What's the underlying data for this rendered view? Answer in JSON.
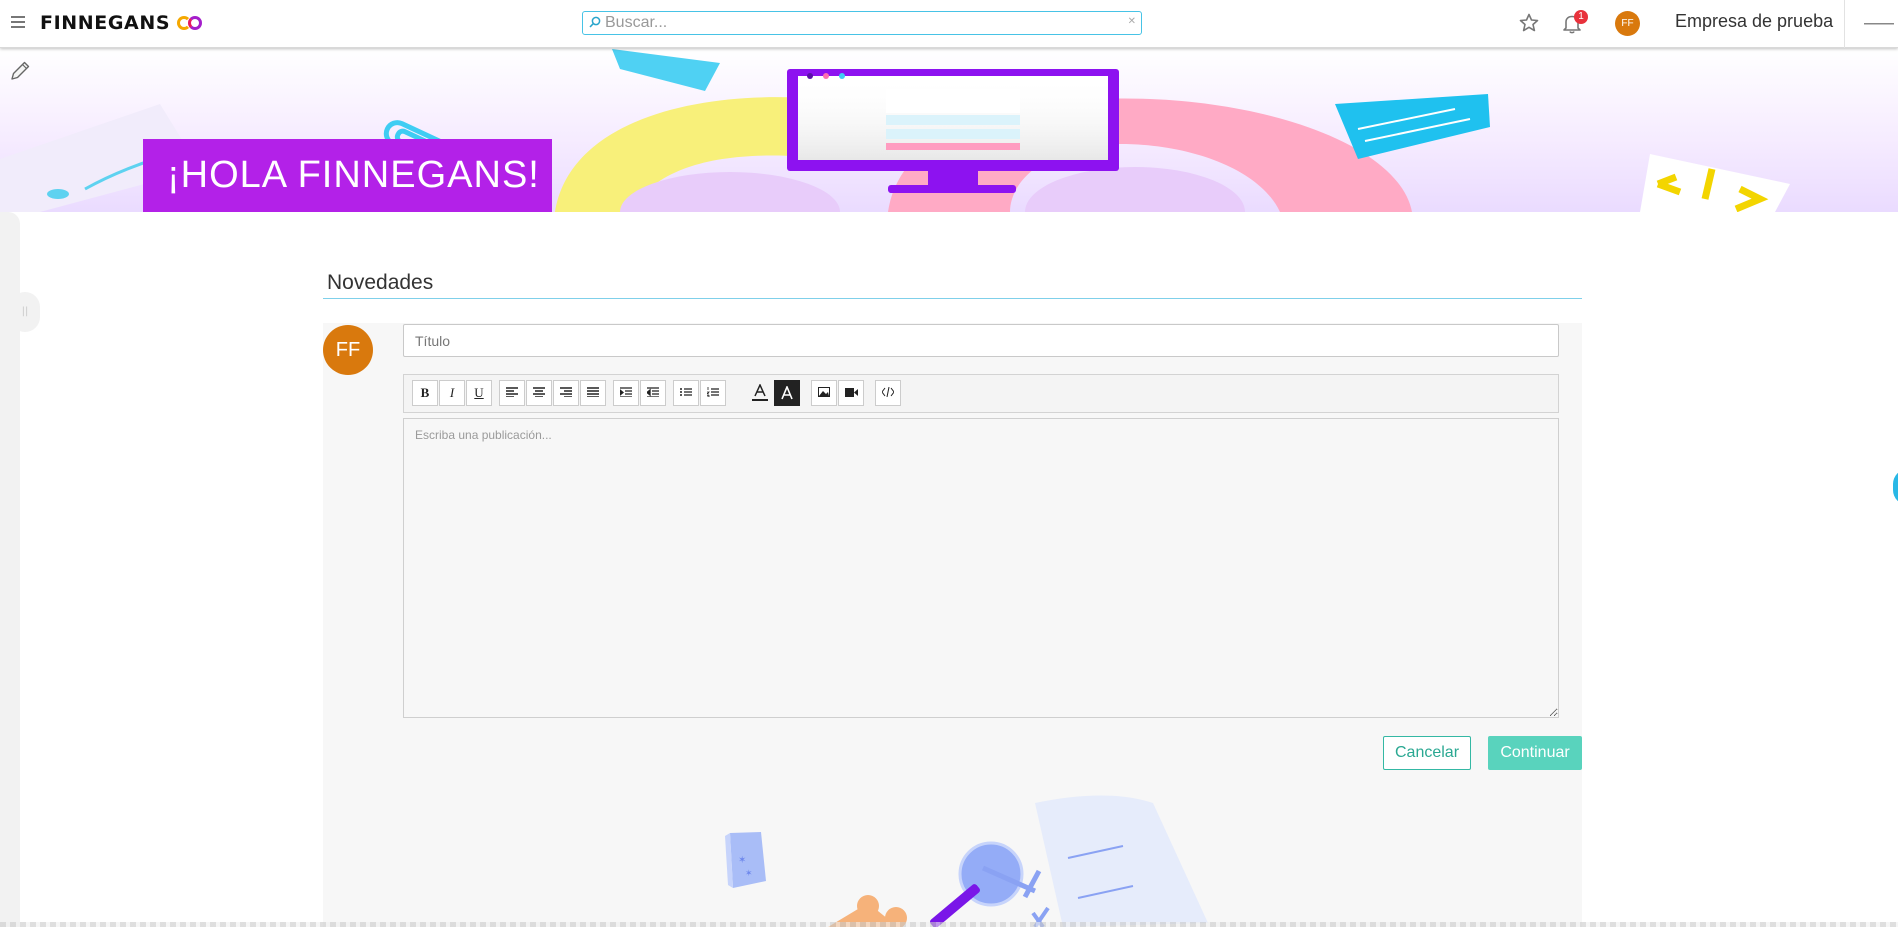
{
  "topbar": {
    "brand": "FINNEGANS",
    "search_placeholder": "Buscar...",
    "notification_count": "1",
    "user_initials": "FF",
    "company_name": "Empresa de prueba"
  },
  "banner": {
    "greeting": "¡HOLA FINNEGANS!"
  },
  "news": {
    "section_title": "Novedades",
    "author_initials": "FF",
    "title_placeholder": "Título",
    "body_placeholder": "Escriba una publicación...",
    "cancel_label": "Cancelar",
    "continue_label": "Continuar"
  },
  "toolbar": {
    "buttons": [
      "bold",
      "italic",
      "underline",
      "align-left",
      "align-center",
      "align-right",
      "align-justify",
      "indent",
      "outdent",
      "bullet-list",
      "numbered-list",
      "text-color",
      "highlight-color",
      "image",
      "video",
      "code"
    ],
    "bold": "B",
    "italic": "I",
    "underline": "U"
  },
  "colors": {
    "accent_teal": "#34b8a4",
    "avatar_orange": "#d9790d",
    "banner_purple": "#b321e8",
    "search_border": "#47c3e6"
  }
}
